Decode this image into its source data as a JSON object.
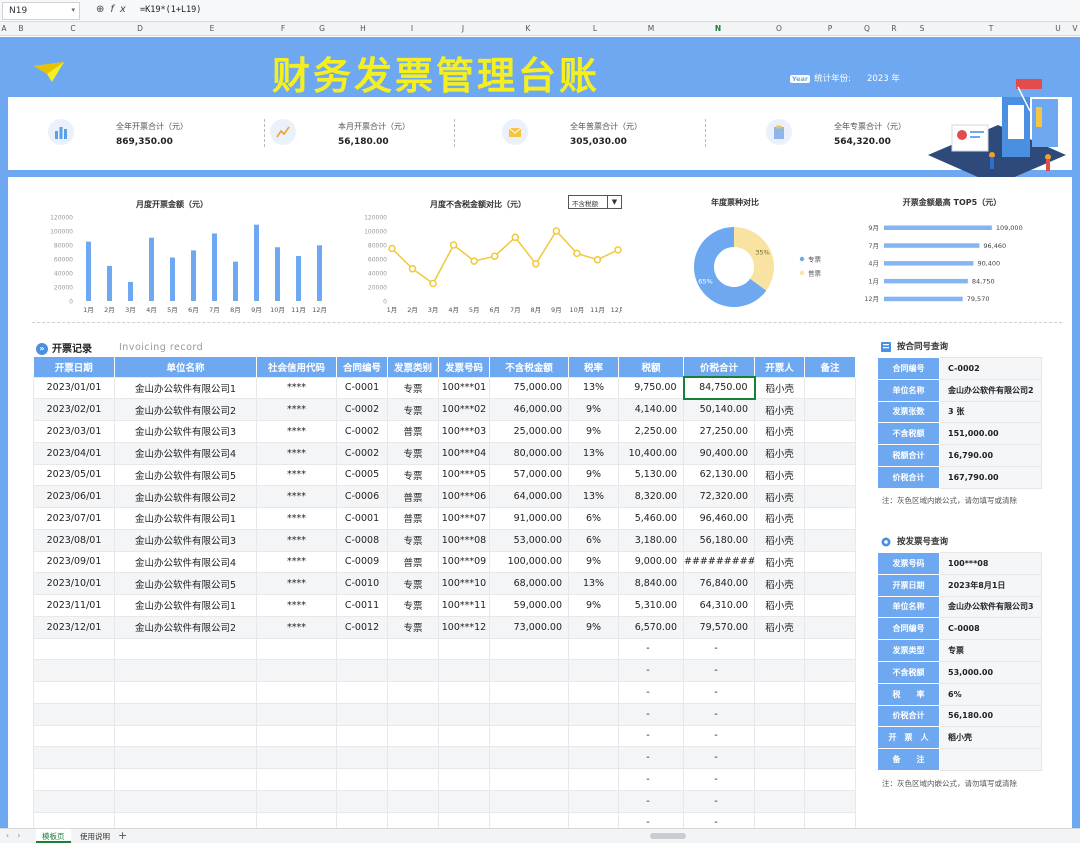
{
  "formula_bar": {
    "cell_ref": "N19",
    "formula": "=K19*(1+L19)"
  },
  "columns": [
    "A",
    "B",
    "C",
    "D",
    "E",
    "F",
    "G",
    "H",
    "I",
    "J",
    "K",
    "L",
    "M",
    "N",
    "O",
    "P",
    "Q",
    "R",
    "S",
    "T",
    "U",
    "V"
  ],
  "selected_column": "N",
  "header": {
    "title": "财务发票管理台账",
    "year_label": "统计年份:",
    "year_value": "2023",
    "year_unit": "年",
    "year_badge": "Year"
  },
  "kpis": [
    {
      "label": "全年开票合计（元）",
      "value": "869,350.00",
      "icon": "bar-chart-icon"
    },
    {
      "label": "本月开票合计（元）",
      "value": "56,180.00",
      "icon": "trend-line-icon"
    },
    {
      "label": "全年普票合计（元）",
      "value": "305,030.00",
      "icon": "envelope-icon"
    },
    {
      "label": "全年专票合计（元）",
      "value": "564,320.00",
      "icon": "clipboard-icon"
    }
  ],
  "charts": {
    "monthly_title": "月度开票金额（元）",
    "pretax_title": "月度不含税金额对比（元）",
    "pretax_dropdown": "不含税额",
    "donut_title": "年度票种对比",
    "top5_title": "开票金额最高 TOP5（元）"
  },
  "chart_data": [
    {
      "type": "bar",
      "title": "月度开票金额（元）",
      "categories": [
        "1月",
        "2月",
        "3月",
        "4月",
        "5月",
        "6月",
        "7月",
        "8月",
        "9月",
        "10月",
        "11月",
        "12月"
      ],
      "values": [
        84750,
        50140,
        27250,
        90400,
        62130,
        72320,
        96460,
        56180,
        109000,
        76840,
        64310,
        79570
      ],
      "ylim": [
        0,
        120000
      ],
      "yticks": [
        0,
        20000,
        40000,
        60000,
        80000,
        100000,
        120000
      ],
      "color": "#6ea8f0"
    },
    {
      "type": "line",
      "title": "月度不含税金额对比（元）",
      "categories": [
        "1月",
        "2月",
        "3月",
        "4月",
        "5月",
        "6月",
        "7月",
        "8月",
        "9月",
        "10月",
        "11月",
        "12月"
      ],
      "values": [
        75000,
        46000,
        25000,
        80000,
        57000,
        64000,
        91000,
        53000,
        100000,
        68000,
        59000,
        73000
      ],
      "ylim": [
        0,
        120000
      ],
      "yticks": [
        0,
        20000,
        40000,
        60000,
        80000,
        100000,
        120000
      ],
      "color": "#f0c93a"
    },
    {
      "type": "pie",
      "title": "年度票种对比",
      "labels": [
        "专票",
        "普票"
      ],
      "values": [
        65,
        35
      ],
      "value_labels": [
        "65%",
        "35%"
      ],
      "colors": [
        "#6ea8f0",
        "#f8e3a3"
      ],
      "legend": "right"
    },
    {
      "type": "bar",
      "orientation": "horizontal",
      "title": "开票金额最高 TOP5（元）",
      "categories": [
        "9月",
        "7月",
        "4月",
        "1月",
        "12月"
      ],
      "values": [
        109000,
        96460,
        90400,
        84750,
        79570
      ],
      "value_labels": [
        "109,000",
        "96,460",
        "90,400",
        "84,750",
        "79,570"
      ],
      "color": "#6ea8f0"
    }
  ],
  "records": {
    "title": "开票记录",
    "subtitle": "Invoicing record",
    "headers": [
      "开票日期",
      "单位名称",
      "社会信用代码",
      "合同编号",
      "发票类别",
      "发票号码",
      "不含税金额",
      "税率",
      "税额",
      "价税合计",
      "开票人",
      "备注"
    ],
    "rows": [
      [
        "2023/01/01",
        "金山办公软件有限公司1",
        "****",
        "C-0001",
        "专票",
        "100***01",
        "75,000.00",
        "13%",
        "9,750.00",
        "84,750.00",
        "稻小壳",
        ""
      ],
      [
        "2023/02/01",
        "金山办公软件有限公司2",
        "****",
        "C-0002",
        "专票",
        "100***02",
        "46,000.00",
        "9%",
        "4,140.00",
        "50,140.00",
        "稻小壳",
        ""
      ],
      [
        "2023/03/01",
        "金山办公软件有限公司3",
        "****",
        "C-0002",
        "普票",
        "100***03",
        "25,000.00",
        "9%",
        "2,250.00",
        "27,250.00",
        "稻小壳",
        ""
      ],
      [
        "2023/04/01",
        "金山办公软件有限公司4",
        "****",
        "C-0002",
        "专票",
        "100***04",
        "80,000.00",
        "13%",
        "10,400.00",
        "90,400.00",
        "稻小壳",
        ""
      ],
      [
        "2023/05/01",
        "金山办公软件有限公司5",
        "****",
        "C-0005",
        "专票",
        "100***05",
        "57,000.00",
        "9%",
        "5,130.00",
        "62,130.00",
        "稻小壳",
        ""
      ],
      [
        "2023/06/01",
        "金山办公软件有限公司2",
        "****",
        "C-0006",
        "普票",
        "100***06",
        "64,000.00",
        "13%",
        "8,320.00",
        "72,320.00",
        "稻小壳",
        ""
      ],
      [
        "2023/07/01",
        "金山办公软件有限公司1",
        "****",
        "C-0001",
        "普票",
        "100***07",
        "91,000.00",
        "6%",
        "5,460.00",
        "96,460.00",
        "稻小壳",
        ""
      ],
      [
        "2023/08/01",
        "金山办公软件有限公司3",
        "****",
        "C-0008",
        "专票",
        "100***08",
        "53,000.00",
        "6%",
        "3,180.00",
        "56,180.00",
        "稻小壳",
        ""
      ],
      [
        "2023/09/01",
        "金山办公软件有限公司4",
        "****",
        "C-0009",
        "普票",
        "100***09",
        "100,000.00",
        "9%",
        "9,000.00",
        "#########",
        "稻小壳",
        ""
      ],
      [
        "2023/10/01",
        "金山办公软件有限公司5",
        "****",
        "C-0010",
        "专票",
        "100***10",
        "68,000.00",
        "13%",
        "8,840.00",
        "76,840.00",
        "稻小壳",
        ""
      ],
      [
        "2023/11/01",
        "金山办公软件有限公司1",
        "****",
        "C-0011",
        "专票",
        "100***11",
        "59,000.00",
        "9%",
        "5,310.00",
        "64,310.00",
        "稻小壳",
        ""
      ],
      [
        "2023/12/01",
        "金山办公软件有限公司2",
        "****",
        "C-0012",
        "专票",
        "100***12",
        "73,000.00",
        "9%",
        "6,570.00",
        "79,570.00",
        "稻小壳",
        ""
      ],
      [
        "",
        "",
        "",
        "",
        "",
        "",
        "",
        "",
        "-",
        "-",
        "",
        ""
      ],
      [
        "",
        "",
        "",
        "",
        "",
        "",
        "",
        "",
        "-",
        "-",
        "",
        ""
      ],
      [
        "",
        "",
        "",
        "",
        "",
        "",
        "",
        "",
        "-",
        "-",
        "",
        ""
      ],
      [
        "",
        "",
        "",
        "",
        "",
        "",
        "",
        "",
        "-",
        "-",
        "",
        ""
      ],
      [
        "",
        "",
        "",
        "",
        "",
        "",
        "",
        "",
        "-",
        "-",
        "",
        ""
      ],
      [
        "",
        "",
        "",
        "",
        "",
        "",
        "",
        "",
        "-",
        "-",
        "",
        ""
      ],
      [
        "",
        "",
        "",
        "",
        "",
        "",
        "",
        "",
        "-",
        "-",
        "",
        ""
      ],
      [
        "",
        "",
        "",
        "",
        "",
        "",
        "",
        "",
        "-",
        "-",
        "",
        ""
      ],
      [
        "",
        "",
        "",
        "",
        "",
        "",
        "",
        "",
        "-",
        "-",
        "",
        ""
      ]
    ]
  },
  "lookup_contract": {
    "title": "按合同号查询",
    "rows": [
      [
        "合同编号",
        "C-0002"
      ],
      [
        "单位名称",
        "金山办公软件有限公司2"
      ],
      [
        "发票张数",
        "3 张"
      ],
      [
        "不含税额",
        "151,000.00"
      ],
      [
        "税额合计",
        "16,790.00"
      ],
      [
        "价税合计",
        "167,790.00"
      ]
    ],
    "note": "注：灰色区域内嵌公式，请勿填写或清除"
  },
  "lookup_invoice": {
    "title": "按发票号查询",
    "rows": [
      [
        "发票号码",
        "100***08"
      ],
      [
        "开票日期",
        "2023年8月1日"
      ],
      [
        "单位名称",
        "金山办公软件有限公司3"
      ],
      [
        "合同编号",
        "C-0008"
      ],
      [
        "发票类型",
        "专票"
      ],
      [
        "不含税额",
        "53,000.00"
      ],
      [
        "税　　率",
        "6%"
      ],
      [
        "价税合计",
        "56,180.00"
      ],
      [
        "开　票　人",
        "稻小壳"
      ],
      [
        "备　　注",
        ""
      ]
    ],
    "note": "注：灰色区域内嵌公式，请勿填写或清除"
  },
  "sheet_tabs": [
    "模板页",
    "使用说明"
  ]
}
